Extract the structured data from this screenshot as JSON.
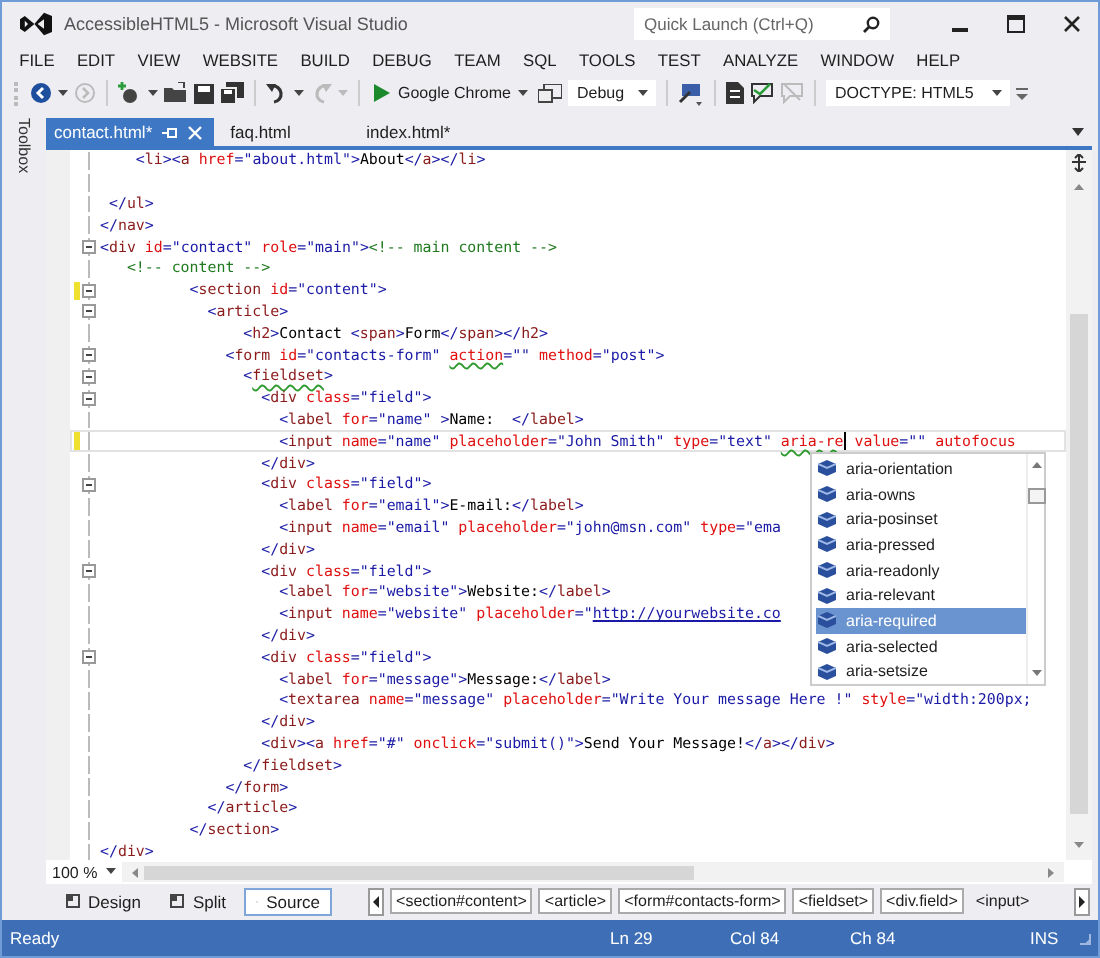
{
  "window": {
    "title": "AccessibleHTML5 - Microsoft Visual Studio"
  },
  "quick_launch": {
    "placeholder": "Quick Launch (Ctrl+Q)"
  },
  "menu": [
    "FILE",
    "EDIT",
    "VIEW",
    "WEBSITE",
    "BUILD",
    "DEBUG",
    "TEAM",
    "SQL",
    "TOOLS",
    "TEST",
    "ANALYZE",
    "WINDOW",
    "HELP"
  ],
  "toolbar": {
    "run_target": "Google Chrome",
    "configuration": "Debug",
    "doctype": "DOCTYPE: HTML5"
  },
  "toolbox": {
    "label": "Toolbox"
  },
  "tabs": [
    {
      "label": "contact.html*",
      "selected": true
    },
    {
      "label": "faq.html",
      "selected": false
    },
    {
      "label": "index.html*",
      "selected": false
    }
  ],
  "editor": {
    "lines": [
      {
        "segments": [
          {
            "kind": "plain",
            "text": "    <li><a href=\"about.html\">About</a></li>"
          }
        ],
        "fold": false,
        "changed": false,
        "current": false
      },
      {
        "fold": false,
        "changed": false,
        "current": false
      },
      {
        "segments": [
          {
            "kind": "plain",
            "text": " </ul>"
          }
        ],
        "fold": false,
        "changed": false,
        "current": false
      },
      {
        "segments": [
          {
            "kind": "plain",
            "text": "</nav>"
          }
        ],
        "fold": false,
        "changed": false,
        "current": false
      },
      {
        "segments": [
          {
            "kind": "plain",
            "text": "<div id=\"contact\" role=\"main\"><!-- main content -->"
          }
        ],
        "fold": true,
        "changed": false,
        "current": false
      },
      {
        "segments": [
          {
            "kind": "plain",
            "text": "   <!-- content -->"
          }
        ],
        "fold": false,
        "changed": false,
        "current": false
      },
      {
        "segments": [
          {
            "kind": "plain",
            "text": "          <section id=\"content\">"
          }
        ],
        "fold": true,
        "changed": true,
        "current": false
      },
      {
        "segments": [
          {
            "kind": "plain",
            "text": "            <article>"
          }
        ],
        "fold": true,
        "changed": false,
        "current": false
      },
      {
        "segments": [
          {
            "kind": "plain",
            "text": "                <h2>Contact <span>Form</span></h2>"
          }
        ],
        "fold": false,
        "changed": false,
        "current": false
      },
      {
        "segments": [
          {
            "kind": "plain",
            "text": "              <form id=\"contacts-form\" "
          },
          {
            "kind": "squiggle",
            "text": "action"
          },
          {
            "kind": "plain",
            "text": "=\"\" method=\"post\">"
          }
        ],
        "fold": true,
        "changed": false,
        "current": false
      },
      {
        "segments": [
          {
            "kind": "plain",
            "text": "                <"
          },
          {
            "kind": "squiggle",
            "text": "fieldset"
          },
          {
            "kind": "plain",
            "text": ">"
          }
        ],
        "fold": true,
        "changed": false,
        "current": false
      },
      {
        "segments": [
          {
            "kind": "plain",
            "text": "                  <div class=\"field\">"
          }
        ],
        "fold": true,
        "changed": false,
        "current": false
      },
      {
        "segments": [
          {
            "kind": "plain",
            "text": "                    <label for=\"name\" >Name:  </label>"
          }
        ],
        "fold": false,
        "changed": false,
        "current": false
      },
      {
        "segments": [
          {
            "kind": "plain",
            "text": "                    <input name=\"name\" placeholder=\"John Smith\" type=\"text\" "
          },
          {
            "kind": "squiggle",
            "text": "aria-re",
            "caret": true
          },
          {
            "kind": "plain",
            "text": " value=\"\" autofocus"
          }
        ],
        "fold": false,
        "changed": true,
        "current": true
      },
      {
        "segments": [
          {
            "kind": "plain",
            "text": "                  </div>"
          }
        ],
        "fold": false,
        "changed": false,
        "current": false
      },
      {
        "segments": [
          {
            "kind": "plain",
            "text": "                  <div class=\"field\">"
          }
        ],
        "fold": true,
        "changed": false,
        "current": false
      },
      {
        "segments": [
          {
            "kind": "plain",
            "text": "                    <label for=\"email\">E-mail:</label>"
          }
        ],
        "fold": false,
        "changed": false,
        "current": false
      },
      {
        "segments": [
          {
            "kind": "plain",
            "text": "                    <input name=\"email\" placeholder=\"john@msn.com\" type=\"ema"
          }
        ],
        "fold": false,
        "changed": false,
        "current": false
      },
      {
        "segments": [
          {
            "kind": "plain",
            "text": "                  </div>"
          }
        ],
        "fold": false,
        "changed": false,
        "current": false
      },
      {
        "segments": [
          {
            "kind": "plain",
            "text": "                  <div class=\"field\">"
          }
        ],
        "fold": true,
        "changed": false,
        "current": false
      },
      {
        "segments": [
          {
            "kind": "plain",
            "text": "                    <label for=\"website\">Website:</label>"
          }
        ],
        "fold": false,
        "changed": false,
        "current": false
      },
      {
        "segments": [
          {
            "kind": "plain",
            "text": "                    <input name=\"website\" placeholder=\""
          },
          {
            "kind": "link",
            "text": "http://yourwebsite.co"
          }
        ],
        "fold": false,
        "changed": false,
        "current": false
      },
      {
        "segments": [
          {
            "kind": "plain",
            "text": "                  </div>"
          }
        ],
        "fold": false,
        "changed": false,
        "current": false
      },
      {
        "segments": [
          {
            "kind": "plain",
            "text": "                  <div class=\"field\">"
          }
        ],
        "fold": true,
        "changed": false,
        "current": false
      },
      {
        "segments": [
          {
            "kind": "plain",
            "text": "                    <label for=\"message\">Message:</label>"
          }
        ],
        "fold": false,
        "changed": false,
        "current": false
      },
      {
        "segments": [
          {
            "kind": "plain",
            "text": "                    <textarea name=\"message\" placeholder=\"Write Your message Here !\" style=\"width:200px;"
          }
        ],
        "fold": false,
        "changed": false,
        "current": false
      },
      {
        "segments": [
          {
            "kind": "plain",
            "text": "                  </div>"
          }
        ],
        "fold": false,
        "changed": false,
        "current": false
      },
      {
        "segments": [
          {
            "kind": "plain",
            "text": "                  <div><a href=\"#\" onclick=\"submit()\">Send Your Message!</a></div>"
          }
        ],
        "fold": false,
        "changed": false,
        "current": false
      },
      {
        "segments": [
          {
            "kind": "plain",
            "text": "                </fieldset>"
          }
        ],
        "fold": false,
        "changed": false,
        "current": false
      },
      {
        "segments": [
          {
            "kind": "plain",
            "text": "              </form>"
          }
        ],
        "fold": false,
        "changed": false,
        "current": false
      },
      {
        "segments": [
          {
            "kind": "plain",
            "text": "            </article>"
          }
        ],
        "fold": false,
        "changed": false,
        "current": false
      },
      {
        "segments": [
          {
            "kind": "plain",
            "text": "          </section>"
          }
        ],
        "fold": false,
        "changed": false,
        "current": false
      },
      {
        "segments": [
          {
            "kind": "plain",
            "text": "</div>"
          }
        ],
        "fold": false,
        "changed": false,
        "current": false
      }
    ],
    "completion": [
      {
        "label": "aria-orientation",
        "selected": false
      },
      {
        "label": "aria-owns",
        "selected": false
      },
      {
        "label": "aria-posinset",
        "selected": false
      },
      {
        "label": "aria-pressed",
        "selected": false
      },
      {
        "label": "aria-readonly",
        "selected": false
      },
      {
        "label": "aria-relevant",
        "selected": false
      },
      {
        "label": "aria-required",
        "selected": true
      },
      {
        "label": "aria-selected",
        "selected": false
      },
      {
        "label": "aria-setsize",
        "selected": false
      }
    ],
    "zoom": "100 %"
  },
  "view_tabs": [
    {
      "label": "Design",
      "selected": false
    },
    {
      "label": "Split",
      "selected": false
    },
    {
      "label": "Source",
      "selected": true
    }
  ],
  "breadcrumb": [
    {
      "label": "<section#content>",
      "selected": false
    },
    {
      "label": "<article>",
      "selected": false
    },
    {
      "label": "<form#contacts-form>",
      "selected": false
    },
    {
      "label": "<fieldset>",
      "selected": false
    },
    {
      "label": "<div.field>",
      "selected": false
    },
    {
      "label": "<input>",
      "selected": true
    }
  ],
  "status_bar": {
    "message": "Ready",
    "line": "Ln 29",
    "column": "Col 84",
    "char": "Ch 84",
    "mode": "INS"
  }
}
